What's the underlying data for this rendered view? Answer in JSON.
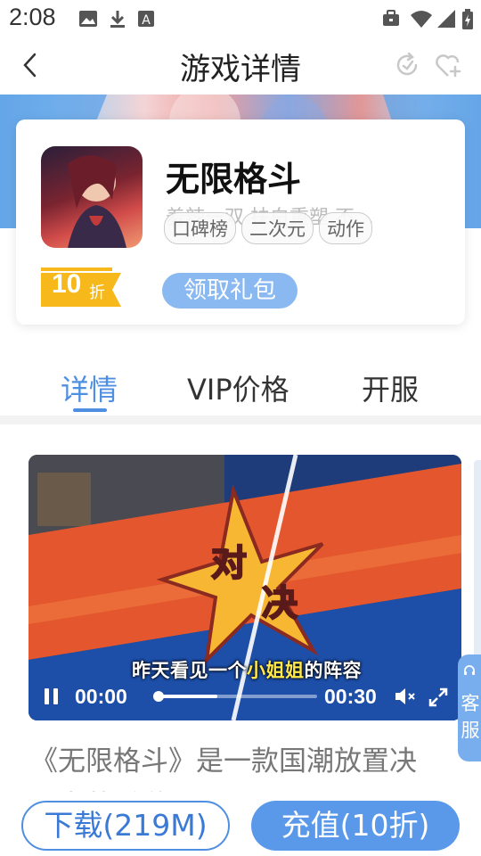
{
  "status_bar": {
    "time": "2:08",
    "left_icons": [
      "image-icon",
      "download-icon",
      "text-a-icon"
    ],
    "right_icons": [
      "briefcase-icon",
      "wifi-icon",
      "signal-icon",
      "battery-charging-icon"
    ]
  },
  "title_bar": {
    "title": "游戏详情",
    "back_icon": "chevron-left-icon",
    "actions": [
      "refresh-icon",
      "heart-plus-icon"
    ]
  },
  "game": {
    "name": "无限格斗",
    "description": "羞辣一双 扶白重塑 不…",
    "tags": [
      "口碑榜",
      "二次元",
      "动作"
    ],
    "tags_more": "不…",
    "discount": {
      "value": "10",
      "unit": "折"
    },
    "gift_button": "领取礼包"
  },
  "tabs": [
    {
      "label": "详情",
      "active": true
    },
    {
      "label": "VIP价格",
      "active": false
    },
    {
      "label": "开服",
      "active": false
    }
  ],
  "video": {
    "subtitle_before": "昨天看见一个",
    "subtitle_highlight": "小姐姐",
    "subtitle_after": "的阵容",
    "overlay_text": "对决",
    "time_current": "00:00",
    "time_total": "00:30",
    "progress": 0.0,
    "buffered": 0.38
  },
  "service": {
    "label": "客服"
  },
  "intro": {
    "line1": "《无限格斗》是一款国潮放置决",
    "line2": "斗卡牌手游…"
  },
  "bottom_bar": {
    "download_label": "下载(219M)",
    "recharge_label": "充值(10折)"
  },
  "colors": {
    "accent": "#4f8fe2",
    "recharge": "#5a98ea",
    "gift": "#8ab8f0",
    "discount": "#f6b81a"
  }
}
